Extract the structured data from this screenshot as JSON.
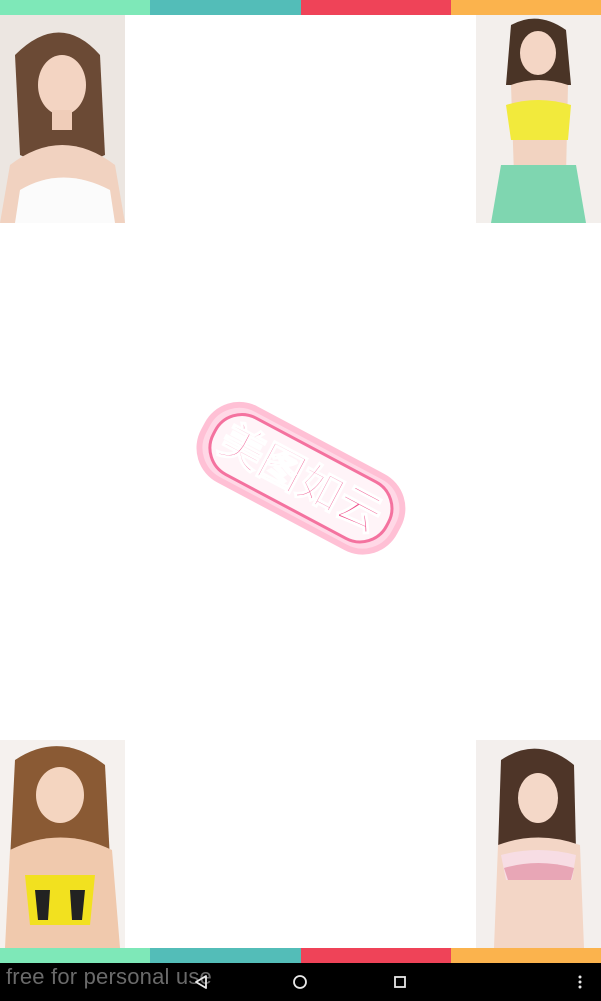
{
  "stripes": {
    "colors": [
      "#7ee8b8",
      "#53bdb8",
      "#ef4358",
      "#fbb34d"
    ]
  },
  "splash": {
    "logo_text": "美图如云",
    "logo_color": "#ee4f8a",
    "corner_photos": [
      "photo-top-left",
      "photo-top-right",
      "photo-bottom-left",
      "photo-bottom-right"
    ]
  },
  "watermark": {
    "text": "free for personal use"
  },
  "navbar": {
    "back_icon": "back-triangle-icon",
    "home_icon": "home-circle-icon",
    "recent_icon": "recent-square-icon",
    "menu_icon": "overflow-menu-icon"
  }
}
